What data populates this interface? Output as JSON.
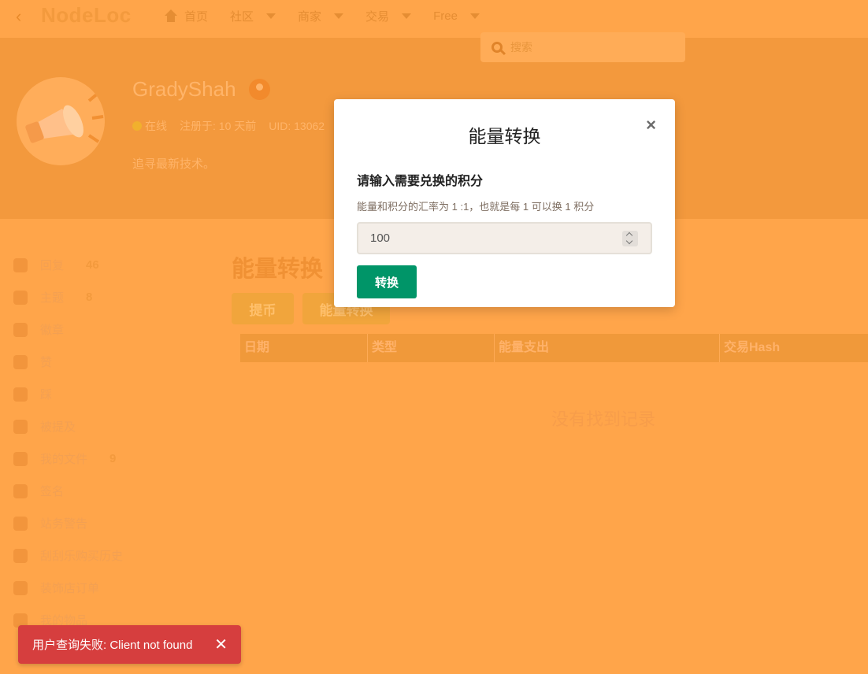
{
  "header": {
    "logo": "NodeLoc",
    "nav": [
      {
        "label": "首页"
      },
      {
        "label": "社区"
      },
      {
        "label": "商家"
      },
      {
        "label": "交易"
      },
      {
        "label": "Free"
      }
    ],
    "search_placeholder": "搜索"
  },
  "profile": {
    "username": "GradyShah",
    "status": "在线",
    "registered": "注册于: 10 天前",
    "uid": "UID: 13062",
    "bio": "追寻最新技术。"
  },
  "sidebar": {
    "items": [
      {
        "label": "回复",
        "count": "46",
        "icon": "comment-icon"
      },
      {
        "label": "主题",
        "count": "8",
        "icon": "list-icon"
      },
      {
        "label": "徽章",
        "count": "",
        "icon": "user-badge-icon"
      },
      {
        "label": "赞",
        "count": "",
        "icon": "thumbs-up-icon"
      },
      {
        "label": "踩",
        "count": "",
        "icon": "thumbs-down-icon"
      },
      {
        "label": "被提及",
        "count": "",
        "icon": "at-icon"
      },
      {
        "label": "我的文件",
        "count": "9",
        "icon": "file-icon"
      },
      {
        "label": "签名",
        "count": "",
        "icon": "signature-icon"
      },
      {
        "label": "站务警告",
        "count": "",
        "icon": "warning-icon"
      },
      {
        "label": "刮刮乐购买历史",
        "count": "",
        "icon": "ticket-icon"
      },
      {
        "label": "装饰店订单",
        "count": "",
        "icon": "store-icon"
      },
      {
        "label": "我的物品",
        "count": "",
        "icon": "box-icon"
      }
    ]
  },
  "main": {
    "section_title": "能量转换",
    "buttons": {
      "withdraw": "提币",
      "convert": "能量转换"
    },
    "table_headers": [
      "日期",
      "类型",
      "能量支出",
      "交易Hash"
    ],
    "empty_text": "没有找到记录"
  },
  "modal": {
    "title": "能量转换",
    "close": "×",
    "label": "请输入需要兑换的积分",
    "help": "能量和积分的汇率为 1 :1，也就是每 1 可以换 1 积分",
    "input_value": "100",
    "submit": "转换"
  },
  "toast": {
    "message": "用户查询失败: Client not found",
    "close": "✕"
  },
  "colors": {
    "overlay": "#ffa54a",
    "primary_green": "#009568",
    "toast_red": "#d63e3e"
  }
}
